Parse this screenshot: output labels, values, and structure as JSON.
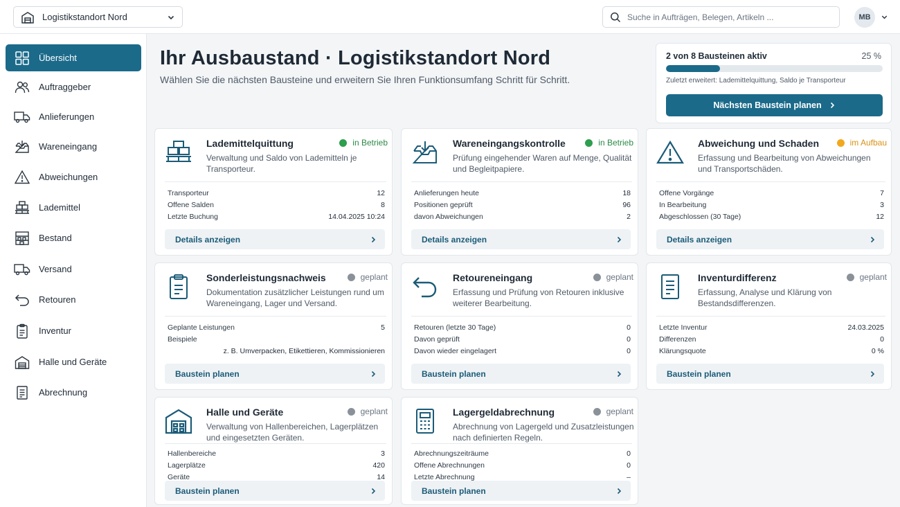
{
  "topbar": {
    "site_label": "Logistikstandort Nord",
    "search_placeholder": "Suche in Aufträgen, Belegen, Artikeln ...",
    "user_initials": "MB"
  },
  "sidebar": {
    "items": [
      {
        "label": "Übersicht",
        "icon": "grid-icon",
        "active": true
      },
      {
        "label": "Auftraggeber",
        "icon": "users-icon"
      },
      {
        "label": "Anlieferungen",
        "icon": "truck-icon"
      },
      {
        "label": "Wareneingang",
        "icon": "inbox-download-icon"
      },
      {
        "label": "Abweichungen",
        "icon": "warning-icon"
      },
      {
        "label": "Lademittel",
        "icon": "pallet-boxes-icon"
      },
      {
        "label": "Bestand",
        "icon": "shelf-icon"
      },
      {
        "label": "Versand",
        "icon": "truck-icon"
      },
      {
        "label": "Retouren",
        "icon": "return-arrow-icon"
      },
      {
        "label": "Inventur",
        "icon": "clipboard-icon"
      },
      {
        "label": "Halle und Geräte",
        "icon": "warehouse-icon"
      },
      {
        "label": "Abrechnung",
        "icon": "document-icon"
      }
    ]
  },
  "header": {
    "title": "Ihr Ausbaustand · Logistikstandort Nord",
    "subtitle": "Wählen Sie die nächsten Bausteine und erweitern Sie Ihren Funktionsumfang Schritt für Schritt."
  },
  "progress": {
    "title": "2 von 8 Bausteinen aktiv",
    "percent_label": "25 %",
    "fraction": 0.25,
    "note": "Zuletzt erweitert: Lademittelquittung, Saldo je Transporteur",
    "button_label": "Nächsten Baustein planen"
  },
  "colors": {
    "accent": "#1b6a8a",
    "status_active": "#2e9e4f",
    "status_building": "#f2a81d",
    "status_planned": "#8a9199"
  },
  "cards": [
    {
      "title": "Lademittelquittung",
      "icon": "pallet-boxes-icon",
      "status": "in Betrieb",
      "status_type": "active",
      "description": "Verwaltung und Saldo von Lademitteln je Transporteur.",
      "stats": [
        {
          "label": "Transporteur",
          "value": "12"
        },
        {
          "label": "Offene Salden",
          "value": "8"
        },
        {
          "label": "Letzte Buchung",
          "value": "14.04.2025   10:24"
        }
      ],
      "action": "Details anzeigen"
    },
    {
      "title": "Wareneingangskontrolle",
      "icon": "inbox-download-icon",
      "status": "in Betrieb",
      "status_type": "active",
      "description": "Prüfung eingehender Waren auf Menge, Qualität und Begleitpapiere.",
      "stats": [
        {
          "label": "Anlieferungen heute",
          "value": "18"
        },
        {
          "label": "Positionen geprüft",
          "value": "96"
        },
        {
          "label": "davon Abweichungen",
          "value": "2"
        }
      ],
      "action": "Details anzeigen"
    },
    {
      "title": "Abweichung und Schaden",
      "icon": "warning-icon",
      "status": "im Aufbau",
      "status_type": "building",
      "description": "Erfassung und Bearbeitung von Abweichungen und Transportschäden.",
      "stats": [
        {
          "label": "Offene Vorgänge",
          "value": "7"
        },
        {
          "label": "In Bearbeitung",
          "value": "3"
        },
        {
          "label": "Abgeschlossen (30 Tage)",
          "value": "12"
        }
      ],
      "action": "Details anzeigen"
    },
    {
      "title": "Sonderleistungsnachweis",
      "icon": "clipboard-icon",
      "status": "geplant",
      "status_type": "planned",
      "description": "Dokumentation zusätzlicher Leistungen rund um Wareneingang, Lager und Versand.",
      "stats": [
        {
          "label": "Geplante Leistungen",
          "value": "5"
        },
        {
          "label": "Beispiele",
          "value": ""
        },
        {
          "label": "",
          "value": "z. B. Umverpacken, Etikettieren, Kommissionieren"
        }
      ],
      "action": "Baustein planen"
    },
    {
      "title": "Retoureneingang",
      "icon": "return-arrow-icon",
      "status": "geplant",
      "status_type": "planned",
      "description": "Erfassung und Prüfung von Retouren inklusive weiterer Bearbeitung.",
      "stats": [
        {
          "label": "Retouren (letzte 30 Tage)",
          "value": "0"
        },
        {
          "label": "Davon geprüft",
          "value": "0"
        },
        {
          "label": "Davon wieder eingelagert",
          "value": "0"
        }
      ],
      "action": "Baustein planen"
    },
    {
      "title": "Inventurdifferenz",
      "icon": "document-icon",
      "status": "geplant",
      "status_type": "planned",
      "description": "Erfassung, Analyse und Klärung von Bestandsdifferenzen.",
      "stats": [
        {
          "label": "Letzte Inventur",
          "value": "24.03.2025"
        },
        {
          "label": "Differenzen",
          "value": "0"
        },
        {
          "label": "Klärungsquote",
          "value": "0 %"
        }
      ],
      "action": "Baustein planen"
    },
    {
      "title": "Halle und Geräte",
      "icon": "warehouse-icon",
      "status": "geplant",
      "status_type": "planned",
      "description": "Verwaltung von Hallenbereichen, Lagerplätzen und eingesetzten Geräten.",
      "stats": [
        {
          "label": "Hallenbereiche",
          "value": "3"
        },
        {
          "label": "Lagerplätze",
          "value": "420"
        },
        {
          "label": "Geräte",
          "value": "14"
        }
      ],
      "action": "Baustein planen"
    },
    {
      "title": "Lagergeldabrechnung",
      "icon": "calculator-icon",
      "status": "geplant",
      "status_type": "planned",
      "description": "Abrechnung von Lagergeld und Zusatzleistungen nach definierten Regeln.",
      "stats": [
        {
          "label": "Abrechnungszeiträume",
          "value": "0"
        },
        {
          "label": "Offene Abrechnungen",
          "value": "0"
        },
        {
          "label": "Letzte Abrechnung",
          "value": "–"
        }
      ],
      "action": "Baustein planen"
    }
  ]
}
